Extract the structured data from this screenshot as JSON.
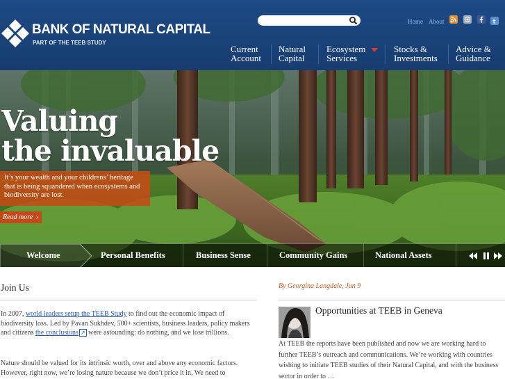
{
  "brand": {
    "title": "BANK OF NATURAL CAPITAL",
    "subtitle": "PART OF THE TEEB STUDY",
    "colors": {
      "header": "#1d4a85",
      "accent": "#c2491a",
      "link": "#2255aa"
    }
  },
  "search": {
    "placeholder": "",
    "icon": "search-icon"
  },
  "utility": {
    "home_label": "Home",
    "about_label": "About",
    "icons": [
      "rss-icon",
      "email-icon",
      "facebook-icon",
      "twitter-icon"
    ]
  },
  "nav": {
    "current_account": "Current\nAccount",
    "natural_capital": "Natural\nCapital",
    "ecosystem_services": "Ecosystem\nServices",
    "stocks_investments": "Stocks &\nInvestments",
    "advice_guidance": "Advice &\nGuidance"
  },
  "hero": {
    "title": "Valuing\nthe invaluable",
    "caption": "It’s your wealth and your childrens’ heritage that is being squandered when ecosystems and biodiversity are lost.",
    "read_more": "Read more"
  },
  "tabs": [
    "Welcome",
    "Personal Benefits",
    "Business Sense",
    "Community Gains",
    "National Assets"
  ],
  "join": {
    "title": "Join Us",
    "p1_before": "In 2007, ",
    "p1_link1": "world leaders setup the TEEB Study",
    "p1_middle": " to find out the economic impact of biodiversity loss. Led by Pavan Sukhdev, 500+ scientists, business leaders, policy makers and citizens ",
    "p1_link2": "the conclusions",
    "p1_after": " were astounding: do nothing, and we lose trillions.",
    "p2": "Nature should be valued for its intrinsic worth, over and above any economic factors. However, right now, we’re losing nature because we don’t price it in. We need to"
  },
  "news": {
    "byline": "By Georgina Langdale, Jun 9",
    "title": "Opportunities at TEEB in Geneva",
    "excerpt": "At TEEB the reports have been published and now we are working hard to further TEEB’s outreach and communications. We’re working with countries wishing to initiate TEEB studies of their Natural Capital, and with the business sector in order to …"
  }
}
